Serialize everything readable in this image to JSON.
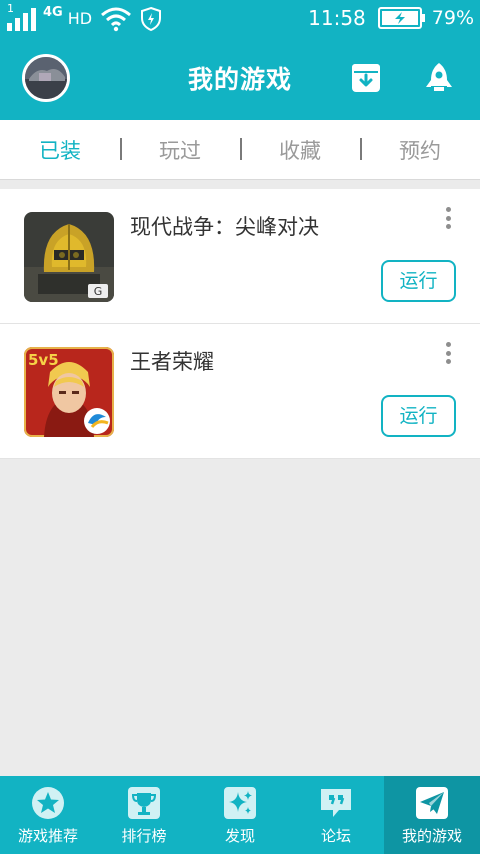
{
  "status_bar": {
    "network_label": "4G",
    "hd_label": "HD",
    "sim_index": "1",
    "time": "11:58",
    "battery_percent": "79%"
  },
  "header": {
    "title": "我的游戏",
    "icons": [
      "download-box-icon",
      "rocket-icon"
    ]
  },
  "tabs": [
    {
      "label": "已装",
      "active": true
    },
    {
      "label": "玩过",
      "active": false
    },
    {
      "label": "收藏",
      "active": false
    },
    {
      "label": "预约",
      "active": false
    }
  ],
  "games": [
    {
      "name": "现代战争：尖峰对决",
      "action": "运行",
      "icon": "soldier-helmet-icon"
    },
    {
      "name": "王者荣耀",
      "action": "运行",
      "icon": "hero-portrait-icon"
    }
  ],
  "bottom_nav": [
    {
      "label": "游戏推荐",
      "icon": "star-icon",
      "active": false
    },
    {
      "label": "排行榜",
      "icon": "trophy-icon",
      "active": false
    },
    {
      "label": "发现",
      "icon": "sparkle-icon",
      "active": false
    },
    {
      "label": "论坛",
      "icon": "quote-bubble-icon",
      "active": false
    },
    {
      "label": "我的游戏",
      "icon": "paper-plane-icon",
      "active": true
    }
  ],
  "colors": {
    "brand": "#12b3c3",
    "brand_dark": "#0e95a3",
    "background": "#ebebeb"
  }
}
